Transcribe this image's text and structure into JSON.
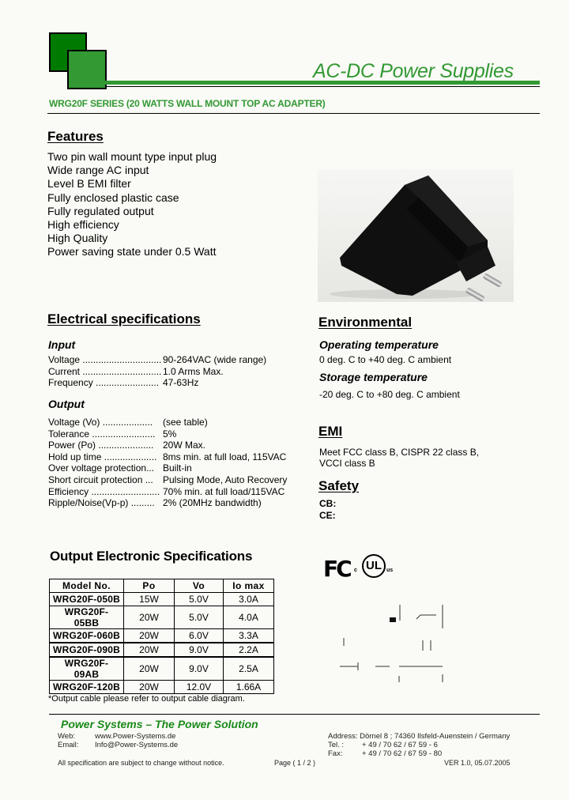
{
  "header": {
    "title": "AC-DC Power Supplies",
    "series": "WRG20F SERIES (20 WATTS WALL MOUNT TOP AC ADAPTER)",
    "colors": {
      "dark_green": "#007a00",
      "green": "#339933"
    }
  },
  "features": {
    "heading": "Features",
    "items": [
      "Two pin wall mount type input plug",
      "Wide range AC input",
      "Level B EMI filter",
      "Fully enclosed plastic case",
      "Fully regulated output",
      "High efficiency",
      "High Quality",
      "Power saving state under 0.5 Watt"
    ]
  },
  "product_image": {
    "alt": "Black wall mount AC adapter with two-pin plug"
  },
  "electrical": {
    "heading": "Electrical specifications",
    "input": {
      "heading": "Input",
      "rows": [
        {
          "key": "Voltage ..............................",
          "value": "90-264VAC (wide range)"
        },
        {
          "key": "Current ..............................",
          "value": "1.0 Arms Max."
        },
        {
          "key": "Frequency ........................",
          "value": "47-63Hz"
        }
      ]
    },
    "output": {
      "heading": "Output",
      "rows": [
        {
          "key": "Voltage (Vo) ...................",
          "value": "(see table)"
        },
        {
          "key": "Tolerance ........................",
          "value": "5%"
        },
        {
          "key": "Power (Po) .....................",
          "value": "20W Max."
        },
        {
          "key": "Hold up time ....................",
          "value": "8ms min. at full load, 115VAC"
        },
        {
          "key": "Over voltage protection...",
          "value": "Built-in"
        },
        {
          "key": "Short circuit protection ...",
          "value": "Pulsing Mode, Auto Recovery"
        },
        {
          "key": "Efficiency ..........................",
          "value": "70% min. at full load/115VAC"
        },
        {
          "key": "Ripple/Noise(Vp-p) .........",
          "value": "2% (20MHz bandwidth)"
        }
      ]
    }
  },
  "environmental": {
    "heading": "Environmental",
    "operating_heading": "Operating temperature",
    "operating_value": "0 deg. C to +40 deg. C ambient",
    "storage_heading": "Storage temperature",
    "storage_value": "-20 deg. C to +80 deg. C ambient"
  },
  "emi": {
    "heading": "EMI",
    "line1": "Meet FCC class B, CISPR 22 class B,",
    "line2": "VCCI class B"
  },
  "safety": {
    "heading": "Safety",
    "cb": "CB:",
    "ce": "CE:"
  },
  "certifications": {
    "fcc": "FC",
    "ul": "UL",
    "ul_left": "c",
    "ul_right": "us"
  },
  "output_table": {
    "heading": "Output Electronic Specifications",
    "columns": [
      "Model No.",
      "Po",
      "Vo",
      "Io max"
    ],
    "rows": [
      [
        "WRG20F-050B",
        "15W",
        "5.0V",
        "3.0A"
      ],
      [
        "WRG20F-05BB",
        "20W",
        "5.0V",
        "4.0A"
      ],
      [
        "WRG20F-060B",
        "20W",
        "6.0V",
        "3.3A"
      ],
      [
        "WRG20F-090B",
        "20W",
        "9.0V",
        "2.2A"
      ],
      [
        "WRG20F-09AB",
        "20W",
        "9.0V",
        "2.5A"
      ],
      [
        "WRG20F-120B",
        "20W",
        "12.0V",
        "1.66A"
      ]
    ],
    "note": "*Output cable please refer to output cable diagram."
  },
  "footer": {
    "slogan": "Power Systems – The Power Solution",
    "web_label": "Web:",
    "web_value": "www.Power-Systems.de",
    "email_label": "Email:",
    "email_value": "Info@Power-Systems.de",
    "address": "Address: Dörnel 8 ; 74360 Ilsfeld-Auenstein / Germany",
    "tel_label": "Tel. :",
    "tel_value": "+ 49 / 70 62 / 67 59 - 6",
    "fax_label": "Fax:",
    "fax_value": "+ 49 / 70 62 / 67 59 - 80",
    "disclaimer": "All specification are subject to change without notice.",
    "page": "Page ( 1 / 2 )",
    "version": "VER 1.0, 05.07.2005"
  }
}
